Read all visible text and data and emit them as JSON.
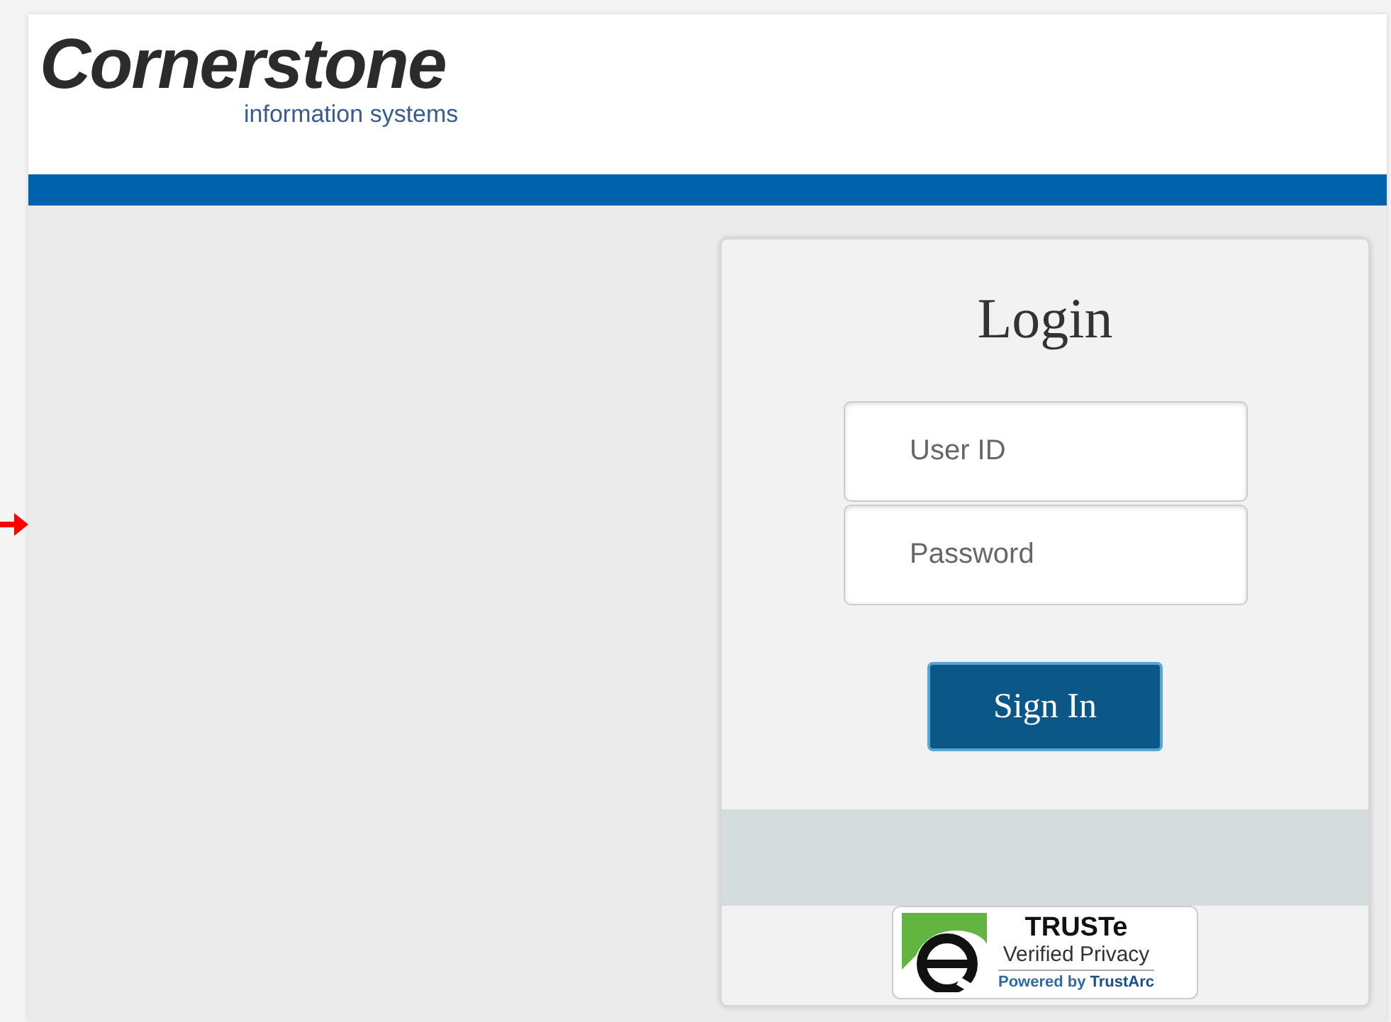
{
  "header": {
    "logo": {
      "name": "Cornerstone",
      "tagline": "information systems"
    }
  },
  "login": {
    "title": "Login",
    "fields": [
      {
        "placeholder": "User ID"
      },
      {
        "placeholder": "Password"
      }
    ],
    "button": "Sign In"
  },
  "badge": {
    "title": "TRUSTe",
    "subtitle": "Verified Privacy",
    "powered_by": "Powered by",
    "brand": "TrustArc"
  }
}
